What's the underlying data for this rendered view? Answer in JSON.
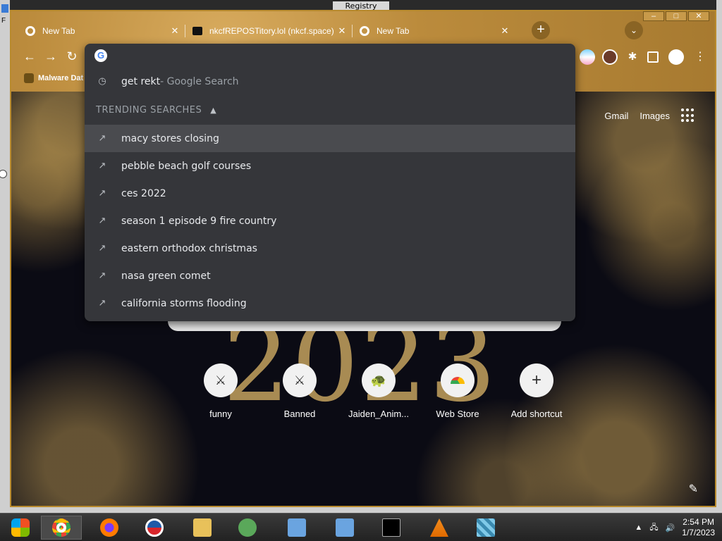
{
  "desktop": {
    "regedit_title": "Registry Editor",
    "side_letter": "F"
  },
  "browser": {
    "tabs": [
      {
        "label": "New Tab",
        "icon": "chrome-icon"
      },
      {
        "label": "nkcfREPOSTitory.lol (nkcf.space)",
        "icon": "folder-icon"
      },
      {
        "label": "New Tab",
        "icon": "chrome-icon"
      }
    ],
    "bookmark": "Malware Dat",
    "window_controls": [
      "–",
      "□",
      "✕"
    ]
  },
  "omnibox": {
    "history_query": "get rekt",
    "history_suffix": " - Google Search",
    "trending_header": "TRENDING SEARCHES",
    "trending": [
      "macy stores closing",
      "pebble beach golf courses",
      "ces 2022",
      "season 1 episode 9 fire country",
      "eastern orthodox christmas",
      "nasa green comet",
      "california storms flooding"
    ]
  },
  "ntp": {
    "gmail": "Gmail",
    "images": "Images",
    "year": "2023",
    "shortcuts": [
      {
        "label": "funny",
        "icon": "sword-icon"
      },
      {
        "label": "Banned",
        "icon": "sword-icon"
      },
      {
        "label": "Jaiden_Anim...",
        "icon": "bird-icon"
      },
      {
        "label": "Web Store",
        "icon": "webstore-icon"
      },
      {
        "label": "Add shortcut",
        "icon": "plus-icon"
      }
    ]
  },
  "tray": {
    "time": "2:54 PM",
    "date": "1/7/2023"
  }
}
